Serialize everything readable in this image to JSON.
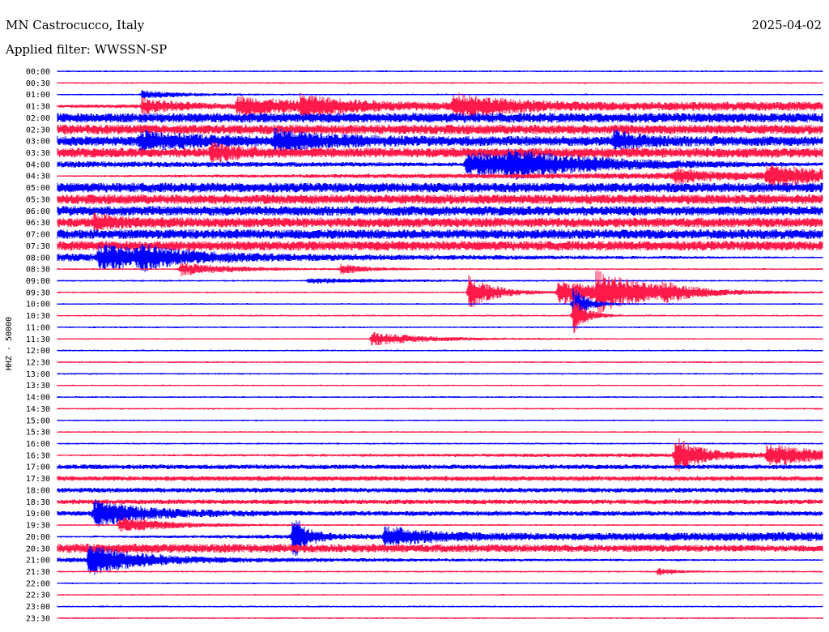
{
  "header": {
    "station": "MN Castrocucco, Italy",
    "date": "2025-04-02",
    "filter": "Applied filter: WWSSN-SP"
  },
  "chart_data": {
    "type": "line",
    "title": "MN Castrocucco, Italy",
    "subtitle": "Applied filter: WWSSN-SP",
    "ylabel": "HHZ - 50000",
    "row_times": [
      "00:00",
      "00:30",
      "01:00",
      "01:30",
      "02:00",
      "02:30",
      "03:00",
      "03:30",
      "04:00",
      "04:30",
      "05:00",
      "05:30",
      "06:00",
      "06:30",
      "07:00",
      "07:30",
      "08:00",
      "08:30",
      "09:00",
      "09:30",
      "10:00",
      "10:30",
      "11:00",
      "11:30",
      "12:00",
      "12:30",
      "13:00",
      "13:30",
      "14:00",
      "14:30",
      "15:00",
      "15:30",
      "16:00",
      "16:30",
      "17:00",
      "17:30",
      "18:00",
      "18:30",
      "19:00",
      "19:30",
      "20:00",
      "20:30",
      "21:00",
      "21:30",
      "22:00",
      "22:30",
      "23:00",
      "23:30"
    ],
    "row_minutes": 30,
    "colors": [
      "#0000ff",
      "#ff1a4a"
    ],
    "grid": false,
    "legend": "none",
    "noise": [
      [
        1,
        1
      ],
      [
        1,
        1
      ],
      [
        1,
        1
      ],
      [
        2,
        6
      ],
      [
        6,
        6
      ],
      [
        6,
        6
      ],
      [
        6,
        6
      ],
      [
        6,
        6
      ],
      [
        4,
        1
      ],
      [
        1,
        5
      ],
      [
        6,
        6
      ],
      [
        6,
        6
      ],
      [
        6,
        6
      ],
      [
        6,
        6
      ],
      [
        6,
        6
      ],
      [
        6,
        6
      ],
      [
        5,
        1
      ],
      [
        1,
        1
      ],
      [
        1,
        1
      ],
      [
        1,
        1
      ],
      [
        1,
        1
      ],
      [
        1,
        1
      ],
      [
        1,
        1
      ],
      [
        1,
        1
      ],
      [
        1,
        1
      ],
      [
        1,
        1
      ],
      [
        1,
        1
      ],
      [
        1,
        1
      ],
      [
        1,
        1
      ],
      [
        1,
        1
      ],
      [
        1,
        1
      ],
      [
        1,
        1
      ],
      [
        1,
        1
      ],
      [
        1,
        3
      ],
      [
        3,
        3
      ],
      [
        3,
        3
      ],
      [
        3,
        3
      ],
      [
        3,
        3
      ],
      [
        3,
        3
      ],
      [
        1,
        1
      ],
      [
        1,
        6
      ],
      [
        6,
        4
      ],
      [
        3,
        1
      ],
      [
        1,
        1
      ],
      [
        1,
        1
      ],
      [
        1,
        1
      ],
      [
        1,
        1
      ],
      [
        1,
        1
      ]
    ],
    "events": [
      {
        "row": 2,
        "minute": 3.3,
        "amplitude": 5,
        "decay": 1.5
      },
      {
        "row": 3,
        "minute": 3.3,
        "amplitude": 9,
        "decay": 1.5
      },
      {
        "row": 3,
        "minute": 7.0,
        "amplitude": 10,
        "decay": 3.0
      },
      {
        "row": 3,
        "minute": 9.5,
        "amplitude": 9,
        "decay": 2.0
      },
      {
        "row": 3,
        "minute": 15.5,
        "amplitude": 14,
        "decay": 2.0
      },
      {
        "row": 6,
        "minute": 3.2,
        "amplitude": 10,
        "decay": 2.0
      },
      {
        "row": 6,
        "minute": 8.5,
        "amplitude": 10,
        "decay": 2.0
      },
      {
        "row": 6,
        "minute": 21.8,
        "amplitude": 10,
        "decay": 1.0
      },
      {
        "row": 7,
        "minute": 6.0,
        "amplitude": 9,
        "decay": 1.0
      },
      {
        "row": 8,
        "minute": 16.0,
        "amplitude": 14,
        "decay": 6.0
      },
      {
        "row": 8,
        "minute": 17.6,
        "amplitude": 9,
        "decay": 2.0
      },
      {
        "row": 9,
        "minute": 24.2,
        "amplitude": 8,
        "decay": 1.0
      },
      {
        "row": 9,
        "minute": 27.8,
        "amplitude": 12,
        "decay": 2.0
      },
      {
        "row": 13,
        "minute": 1.4,
        "amplitude": 7,
        "decay": 1.0
      },
      {
        "row": 16,
        "minute": 1.6,
        "amplitude": 13,
        "decay": 3.0
      },
      {
        "row": 16,
        "minute": 3.2,
        "amplitude": 8,
        "decay": 1.0
      },
      {
        "row": 17,
        "minute": 4.8,
        "amplitude": 8,
        "decay": 2.0
      },
      {
        "row": 17,
        "minute": 11.1,
        "amplitude": 6,
        "decay": 1.0
      },
      {
        "row": 18,
        "minute": 9.8,
        "amplitude": 3,
        "decay": 3.0
      },
      {
        "row": 19,
        "minute": 16.1,
        "amplitude": 22,
        "decay": 1.0
      },
      {
        "row": 19,
        "minute": 19.6,
        "amplitude": 14,
        "decay": 2.5
      },
      {
        "row": 19,
        "minute": 21.1,
        "amplitude": 20,
        "decay": 2.0
      },
      {
        "row": 19,
        "minute": 23.7,
        "amplitude": 7,
        "decay": 1.0
      },
      {
        "row": 20,
        "minute": 20.2,
        "amplitude": 24,
        "decay": 0.5
      },
      {
        "row": 21,
        "minute": 20.2,
        "amplitude": 24,
        "decay": 0.5
      },
      {
        "row": 23,
        "minute": 12.3,
        "amplitude": 8,
        "decay": 2.0
      },
      {
        "row": 33,
        "minute": 24.2,
        "amplitude": 22,
        "decay": 1.0
      },
      {
        "row": 33,
        "minute": 27.8,
        "amplitude": 12,
        "decay": 2.0
      },
      {
        "row": 38,
        "minute": 1.4,
        "amplitude": 16,
        "decay": 2.0
      },
      {
        "row": 39,
        "minute": 2.4,
        "amplitude": 10,
        "decay": 2.0
      },
      {
        "row": 40,
        "minute": 9.2,
        "amplitude": 30,
        "decay": 0.6
      },
      {
        "row": 40,
        "minute": 12.8,
        "amplitude": 12,
        "decay": 2.0
      },
      {
        "row": 42,
        "minute": 1.2,
        "amplitude": 18,
        "decay": 2.0
      },
      {
        "row": 43,
        "minute": 23.5,
        "amplitude": 4,
        "decay": 0.8
      }
    ]
  }
}
